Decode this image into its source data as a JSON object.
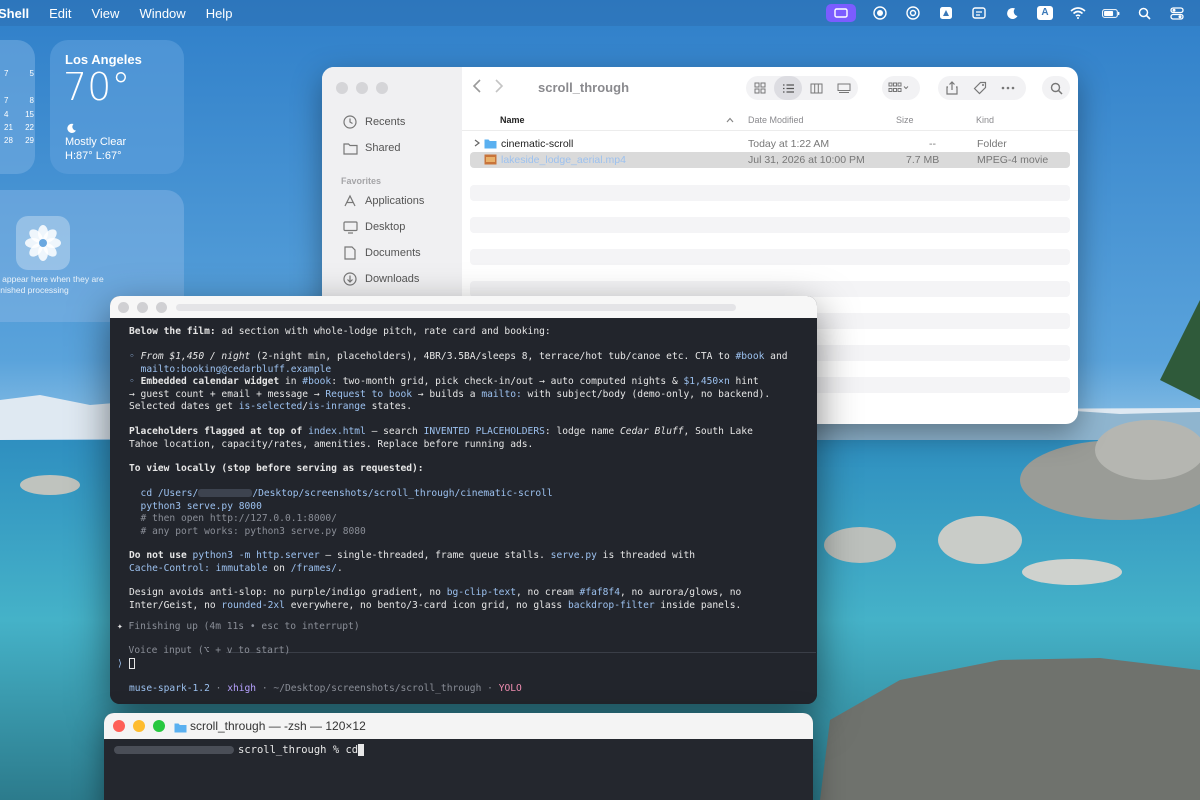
{
  "menubar": {
    "app": "Shell",
    "items": [
      "Edit",
      "View",
      "Window",
      "Help"
    ],
    "status_icons": [
      "screen-record-icon",
      "record-icon",
      "focus-icon",
      "drive-icon",
      "chat-icon",
      "moon-icon",
      "font-a-icon",
      "wifi-icon",
      "battery-icon",
      "search-icon",
      "control-center-icon"
    ],
    "font_icon_label": "A"
  },
  "calendar_widget": {
    "rows": [
      [
        "7",
        "5"
      ],
      [
        "7",
        "8"
      ],
      [
        "4",
        "15"
      ],
      [
        "21",
        "22"
      ],
      [
        "28",
        "29"
      ]
    ]
  },
  "weather_widget": {
    "city": "Los Angeles",
    "temp": "70°",
    "condition": "Mostly Clear",
    "hilo": "H:87° L:67°"
  },
  "photos_widget": {
    "line1": "ll appear here when they are",
    "line2": "finished processing"
  },
  "finder": {
    "title": "scroll_through",
    "sidebar": {
      "recents": "Recents",
      "shared": "Shared",
      "favorites_header": "Favorites",
      "applications": "Applications",
      "desktop": "Desktop",
      "documents": "Documents",
      "downloads": "Downloads"
    },
    "columns": {
      "name": "Name",
      "date": "Date Modified",
      "size": "Size",
      "kind": "Kind"
    },
    "rows": [
      {
        "name": "cinematic-scroll",
        "date": "Today at 1:22 AM",
        "size": "--",
        "kind": "Folder"
      },
      {
        "name": "lakeside_lodge_aerial.mp4",
        "date": "Jul 31, 2026 at 10:00 PM",
        "size": "7.7 MB",
        "kind": "MPEG-4 movie"
      }
    ]
  },
  "codex": {
    "l01a": "Below the film:",
    "l01b": " ad section with whole-lodge pitch, rate card and booking:",
    "l02_bullet": "◦ ",
    "l02_price": "From $1,450 / night",
    "l02_rest": " (2-night min, placeholders), 4BR/3.5BA/sleeps 8, terrace/hot tub/canoe etc. CTA to ",
    "l02_book": "#book",
    "l02_end": " and",
    "l03": "  mailto:booking@cedarbluff.example",
    "l04_bullet": "◦ ",
    "l04_b": "Embedded calendar widget",
    "l04_mid": " in ",
    "l04_book": "#book",
    "l04_rest": ": two-month grid, pick check-in/out → auto computed nights & ",
    "l04_price": "$1,450×n",
    "l04_end": " hint",
    "l05a": "→ guest count + email + message → ",
    "l05b": "Request to book",
    "l05c": " → builds a ",
    "l05d": "mailto:",
    "l05e": " with subject/body (demo-only, no backend).",
    "l06a": "Selected dates get ",
    "l06b": "is-selected",
    "l06c": "/",
    "l06d": "is-inrange",
    "l06e": " states.",
    "l07a": "Placeholders flagged at top of ",
    "l07b": "index.html",
    "l07c": " — search ",
    "l07d": "INVENTED PLACEHOLDERS",
    "l07e": ": lodge name ",
    "l07f": "Cedar Bluff",
    "l07g": ", South Lake",
    "l08": "Tahoe location, capacity/rates, amenities. Replace before running ads.",
    "l09": "To view locally (stop before serving as requested):",
    "l10a": "  cd /Users/",
    "l10b": "/Desktop/screenshots/scroll_through/cinematic-scroll",
    "l11": "  python3 serve.py 8000",
    "l12": "  # then open http://127.0.0.1:8000/",
    "l13": "  # any port works: python3 serve.py 8080",
    "l14a": "Do not use ",
    "l14b": "python3 -m http.server",
    "l14c": " — single-threaded, frame queue stalls. ",
    "l14d": "serve.py",
    "l14e": " is threaded with",
    "l15a": "Cache-Control: immutable",
    "l15b": " on ",
    "l15c": "/frames/",
    "l15d": ".",
    "l16a": "Design avoids anti-slop: no purple/indigo gradient, no ",
    "l16b": "bg-clip-text",
    "l16c": ", no cream ",
    "l16d": "#faf8f4",
    "l16e": ", no aurora/glows, no",
    "l17a": "Inter/Geist, no ",
    "l17b": "rounded-2xl",
    "l17c": " everywhere, no bento/3-card icon grid, no glass ",
    "l17d": "backdrop-filter",
    "l17e": " inside panels.",
    "status_glyph": "✦",
    "status_text": " Finishing up ",
    "status_meta": "(4m 11s • esc to interrupt)",
    "voice_hint": "  Voice input (⌥ + v to start)",
    "prompt_glyph": "⟩",
    "footer_model": "muse-spark-1.2",
    "footer_effort": "xhigh",
    "footer_path": "~/Desktop/screenshots/scroll_through",
    "footer_mode": "YOLO",
    "footer_sep": " · "
  },
  "zsh": {
    "title": "scroll_through — -zsh — 120×12",
    "prompt": "scroll_through % ",
    "command": "cd"
  }
}
